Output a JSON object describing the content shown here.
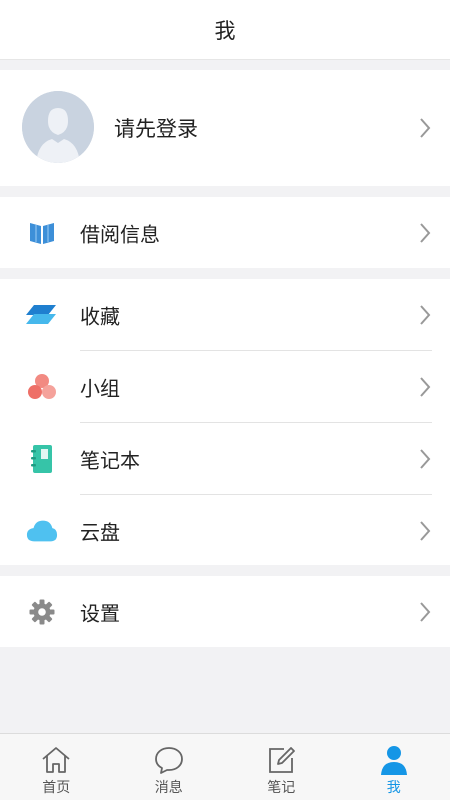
{
  "header": {
    "title": "我"
  },
  "profile": {
    "login_label": "请先登录"
  },
  "borrow": {
    "label": "借阅信息"
  },
  "list": {
    "items": [
      {
        "label": "收藏",
        "icon": "collection-icon"
      },
      {
        "label": "小组",
        "icon": "group-icon"
      },
      {
        "label": "笔记本",
        "icon": "notebook-icon"
      },
      {
        "label": "云盘",
        "icon": "cloud-drive-icon"
      }
    ]
  },
  "settings": {
    "label": "设置"
  },
  "tabbar": {
    "active_color": "#1596e6",
    "tabs": [
      {
        "label": "首页",
        "icon": "home-icon"
      },
      {
        "label": "消息",
        "icon": "message-icon"
      },
      {
        "label": "笔记",
        "icon": "note-icon"
      },
      {
        "label": "我",
        "icon": "profile-icon"
      }
    ]
  }
}
